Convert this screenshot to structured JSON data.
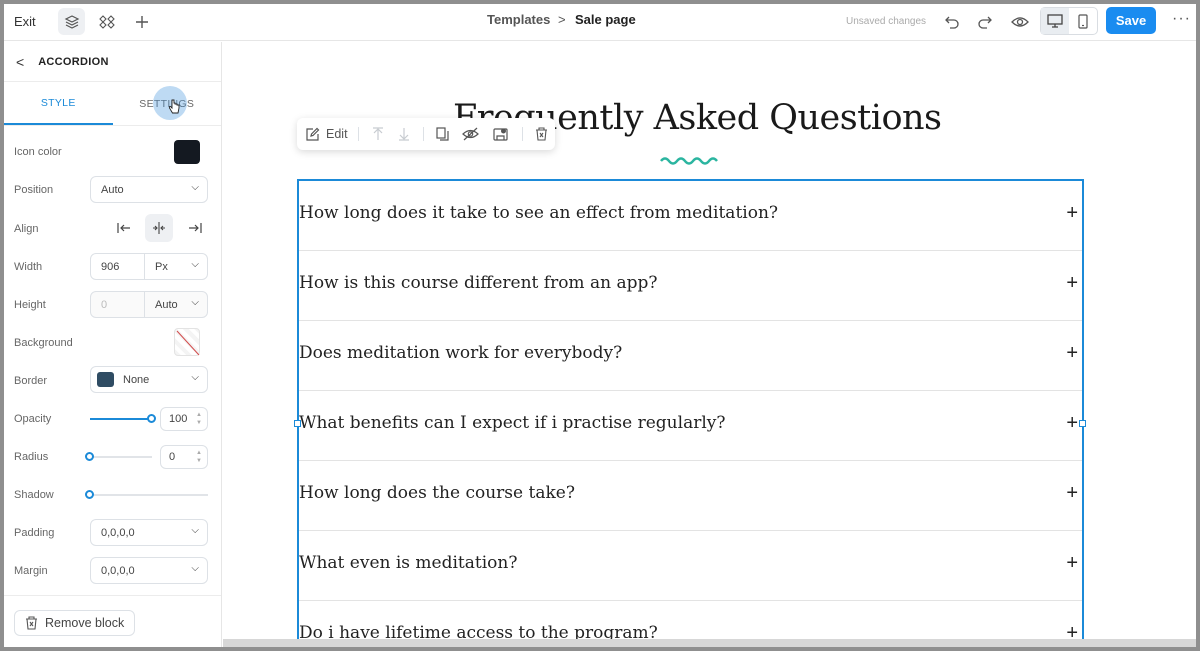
{
  "topbar": {
    "exit_label": "Exit",
    "breadcrumb": [
      "Templates",
      "Sale page"
    ],
    "breadcrumb_sep": ">",
    "unsaved": "Unsaved changes",
    "save_label": "Save",
    "more": "···"
  },
  "panel": {
    "back": "<",
    "title": "ACCORDION",
    "tabs": [
      "STYLE",
      "SETTINGS"
    ],
    "active_tab": "STYLE",
    "fields": {
      "icon_color": {
        "label": "Icon color",
        "color": "#141921"
      },
      "position": {
        "label": "Position",
        "value": "Auto"
      },
      "align": {
        "label": "Align",
        "options": [
          "left",
          "center",
          "right"
        ],
        "active": "center"
      },
      "width": {
        "label": "Width",
        "value": "906",
        "unit": "Px"
      },
      "height": {
        "label": "Height",
        "placeholder": "0",
        "unit": "Auto"
      },
      "background": {
        "label": "Background"
      },
      "border": {
        "label": "Border",
        "value": "None"
      },
      "opacity": {
        "label": "Opacity",
        "value": "100"
      },
      "radius": {
        "label": "Radius",
        "value": "0"
      },
      "shadow": {
        "label": "Shadow"
      },
      "padding": {
        "label": "Padding",
        "value": "0,0,0,0"
      },
      "margin": {
        "label": "Margin",
        "value": "0,0,0,0"
      }
    },
    "remove_label": "Remove block"
  },
  "canvas": {
    "title": "Frequently Asked Questions",
    "toolbar_edit": "Edit",
    "accent": "#2bb5a0",
    "questions": [
      "How long does it take to see an effect from meditation?",
      "How is this course different from an app?",
      "Does meditation work for everybody?",
      "What benefits can I expect if i practise regularly?",
      "How long does the course take?",
      "What even is meditation?",
      "Do i have lifetime access to the program?"
    ],
    "plus": "+"
  }
}
